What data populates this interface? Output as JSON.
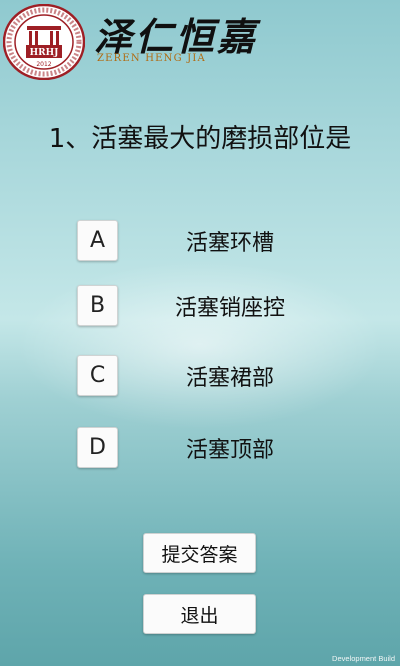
{
  "header": {
    "logo_text": "HRHJ",
    "logo_year": "2012",
    "brand_cn": "泽仁恒嘉",
    "brand_en": "ZEREN HENG JIA"
  },
  "question": {
    "text": "1、活塞最大的磨损部位是"
  },
  "options": [
    {
      "letter": "A",
      "text": "活塞环槽"
    },
    {
      "letter": "B",
      "text": "活塞销座控"
    },
    {
      "letter": "C",
      "text": "活塞裙部"
    },
    {
      "letter": "D",
      "text": "活塞顶部"
    }
  ],
  "actions": {
    "submit_label": "提交答案",
    "exit_label": "退出"
  },
  "footer": {
    "build_label": "Development Build"
  },
  "colors": {
    "seal_red": "#9e1f25",
    "brand_gold": "#b06b12"
  }
}
